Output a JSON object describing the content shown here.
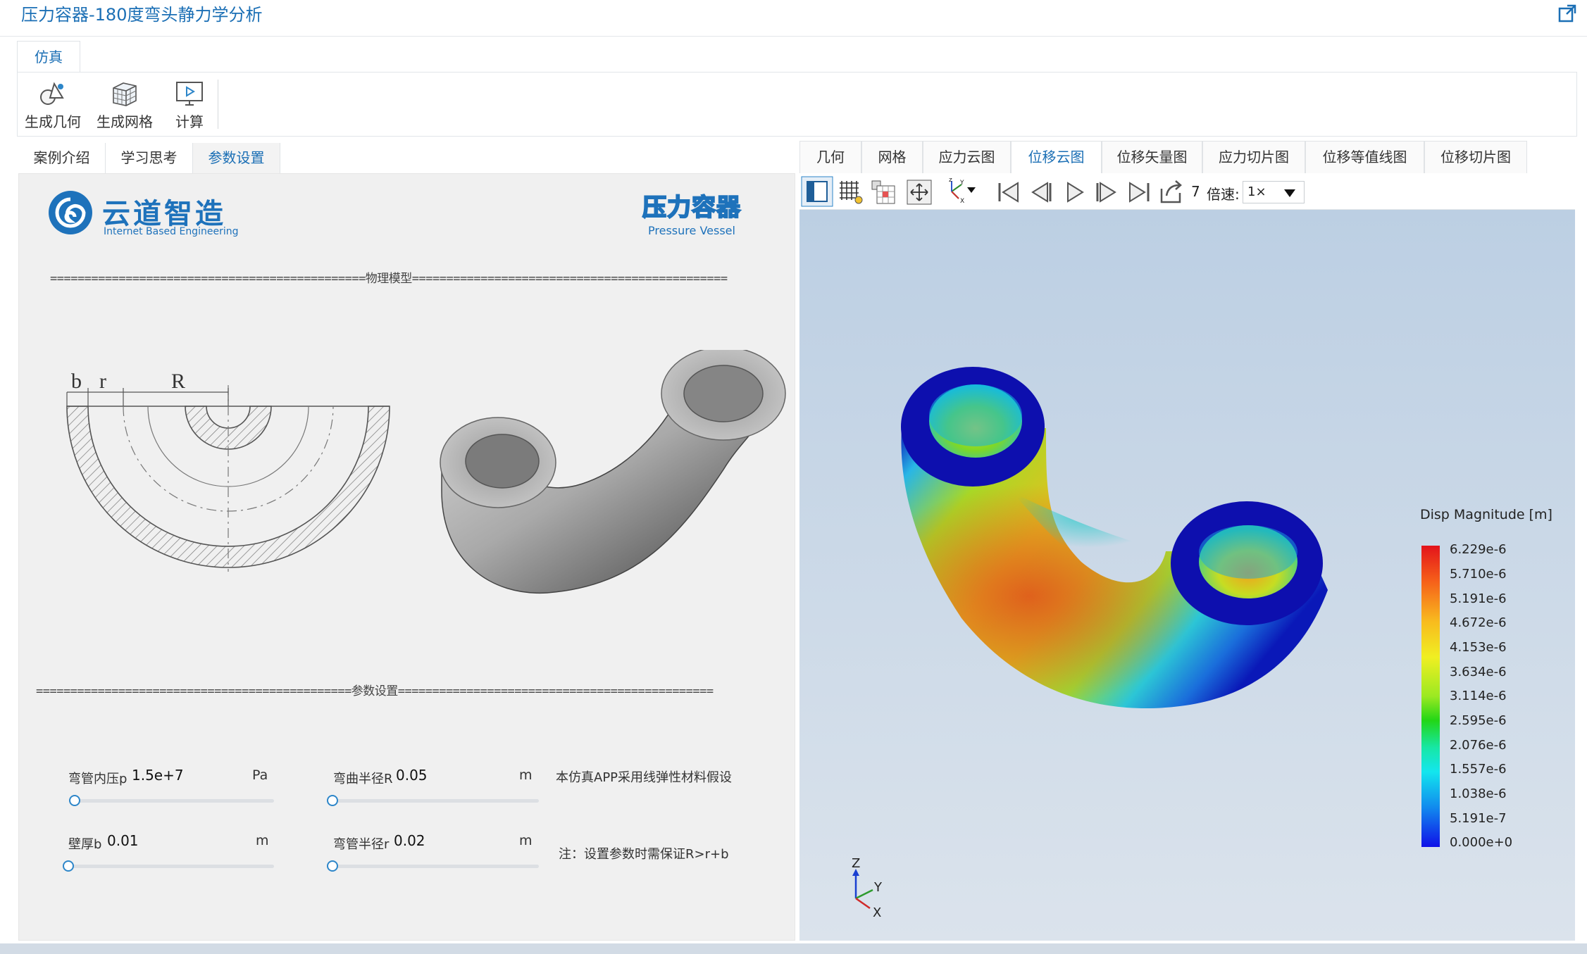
{
  "window": {
    "title": "压力容器-180度弯头静力学分析"
  },
  "ribbon": {
    "tab": "仿真",
    "buttons": {
      "geometry": "生成几何",
      "mesh": "生成网格",
      "compute": "计算"
    }
  },
  "left": {
    "tabs": [
      "案例介绍",
      "学习思考",
      "参数设置"
    ],
    "active_tab": "参数设置",
    "logo": {
      "name": "云道智造",
      "sub": "Internet Based Engineering"
    },
    "badge": {
      "name": "压力容器",
      "sub": "Pressure Vessel"
    },
    "section_physics": "==============================================物理模型==============================================",
    "section_params": "==============================================参数设置==============================================",
    "diagram_labels": {
      "b": "b",
      "r": "r",
      "R": "R"
    },
    "params": [
      {
        "label": "弯管内压p",
        "value": "1.5e+7",
        "unit": "Pa"
      },
      {
        "label": "弯曲半径R",
        "value": "0.05",
        "unit": "m"
      },
      {
        "label": "壁厚b",
        "value": "0.01",
        "unit": "m"
      },
      {
        "label": "弯管半径r",
        "value": "0.02",
        "unit": "m"
      }
    ],
    "notes": {
      "material": "本仿真APP采用线弹性材料假设",
      "constraint": "注：设置参数时需保证R>r+b"
    }
  },
  "right": {
    "tabs": [
      "几何",
      "网格",
      "应力云图",
      "位移云图",
      "位移矢量图",
      "应力切片图",
      "位移等值线图",
      "位移切片图"
    ],
    "active_tab": "位移云图",
    "toolbar": {
      "frame": "7",
      "speed_label": "倍速:",
      "speed_value": "1×",
      "icons": [
        "view-mode-icon",
        "mesh-grid-icon",
        "color-table-icon",
        "fit-view-icon",
        "axes-icon",
        "first-frame-icon",
        "prev-frame-icon",
        "play-icon",
        "next-frame-icon",
        "last-frame-icon",
        "export-icon"
      ]
    },
    "legend": {
      "title": "Disp Magnitude [m]",
      "labels": [
        "6.229e-6",
        "5.710e-6",
        "5.191e-6",
        "4.672e-6",
        "4.153e-6",
        "3.634e-6",
        "3.114e-6",
        "2.595e-6",
        "2.076e-6",
        "1.557e-6",
        "1.038e-6",
        "5.191e-7",
        "0.000e+0"
      ],
      "colors": [
        "#e3131b",
        "#f6611a",
        "#f8ba1e",
        "#f0ef22",
        "#9be922",
        "#22d616",
        "#17e7a5",
        "#13e6ee",
        "#1189ee",
        "#1010e8"
      ]
    },
    "triad": {
      "z": "Z",
      "y": "Y",
      "x": "X"
    }
  }
}
